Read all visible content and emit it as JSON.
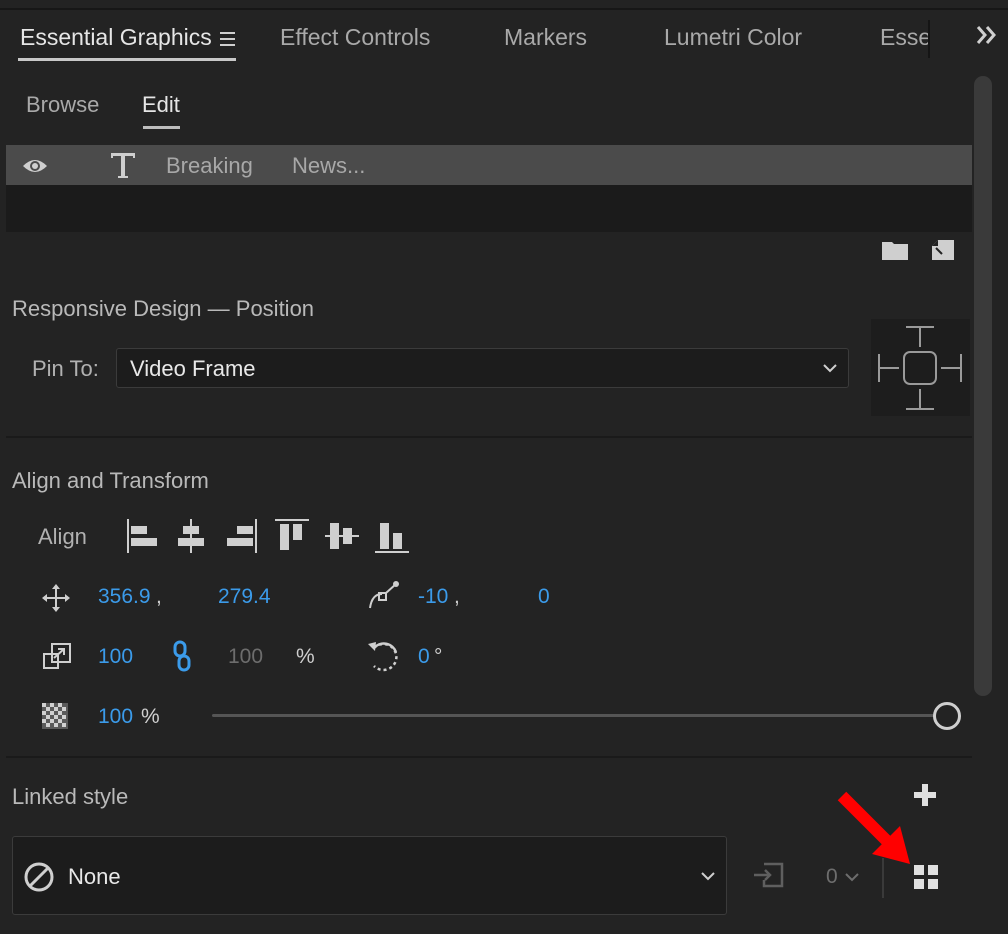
{
  "tabs": [
    {
      "label": "Essential Graphics",
      "active": true
    },
    {
      "label": "Effect Controls",
      "active": false
    },
    {
      "label": "Markers",
      "active": false
    },
    {
      "label": "Lumetri Color",
      "active": false
    },
    {
      "label": "Essen",
      "active": false
    }
  ],
  "overflow_label": "»",
  "subtabs": [
    {
      "label": "Browse",
      "active": false
    },
    {
      "label": "Edit",
      "active": true
    }
  ],
  "layers": [
    {
      "text1": "Breaking",
      "text2": "News..."
    }
  ],
  "responsive": {
    "title": "Responsive Design — Position",
    "pin_label": "Pin To:",
    "pin_value": "Video Frame"
  },
  "align_transform": {
    "title": "Align and Transform",
    "align_label": "Align",
    "position_x": "356.9",
    "position_y": "279.4",
    "anchor_x": "-10",
    "anchor_y": "0",
    "scale_w": "100",
    "scale_h": "100",
    "scale_unit": "%",
    "rotation": "0",
    "rotation_unit": "°",
    "opacity": "100",
    "opacity_unit": "%",
    "opacity_level": 1.0
  },
  "linked_style": {
    "title": "Linked style",
    "value": "None",
    "count": "0"
  },
  "colors": {
    "accent_blue": "#3b9bea",
    "annotation_red": "#ff0000"
  }
}
